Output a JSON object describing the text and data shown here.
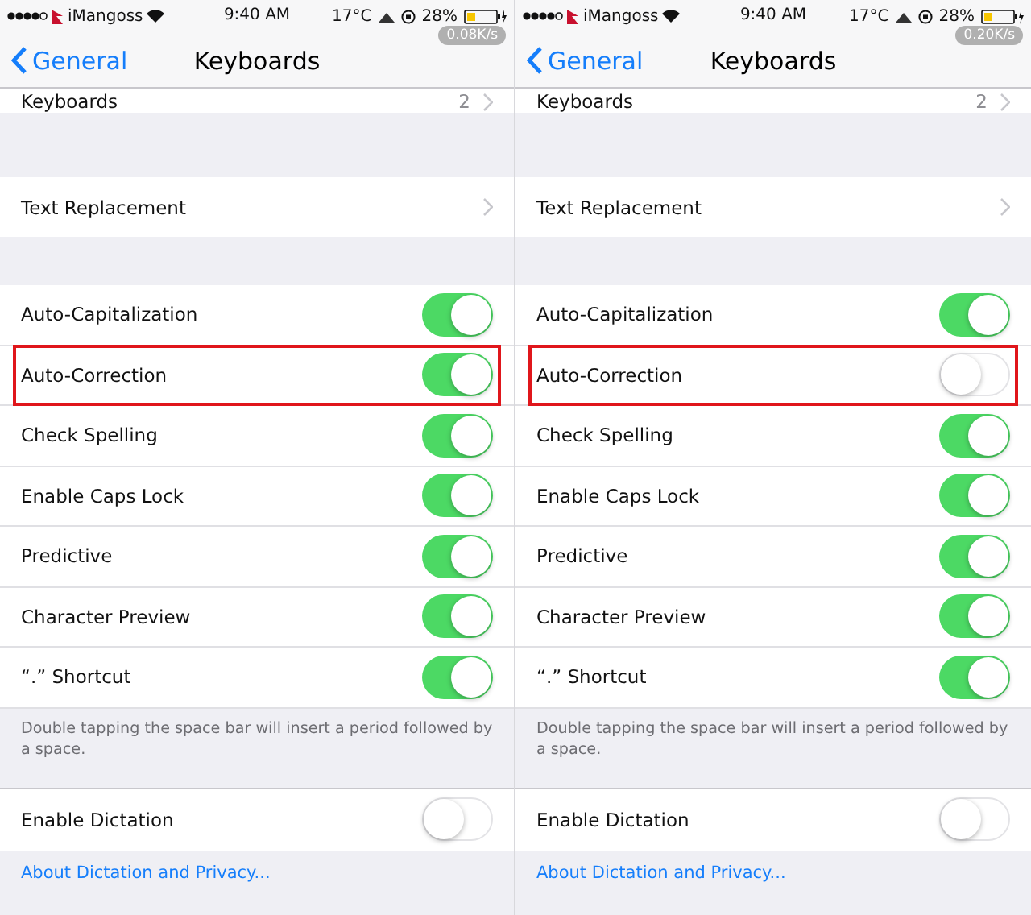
{
  "panels": [
    {
      "status_bar": {
        "carrier": "iMangoss",
        "time": "9:40 AM",
        "temperature": "17°C",
        "battery_percent": "28%",
        "net_speed": "0.08K/s"
      },
      "nav": {
        "back": "General",
        "title": "Keyboards"
      },
      "keyboards_row": {
        "label": "Keyboards",
        "value": "2"
      },
      "text_replacement": {
        "label": "Text Replacement"
      },
      "toggles": [
        {
          "label": "Auto-Capitalization",
          "on": true,
          "highlighted": false
        },
        {
          "label": "Auto-Correction",
          "on": true,
          "highlighted": true
        },
        {
          "label": "Check Spelling",
          "on": true,
          "highlighted": false
        },
        {
          "label": "Enable Caps Lock",
          "on": true,
          "highlighted": false
        },
        {
          "label": "Predictive",
          "on": true,
          "highlighted": false
        },
        {
          "label": "Character Preview",
          "on": true,
          "highlighted": false
        },
        {
          "label": "“.” Shortcut",
          "on": true,
          "highlighted": false
        }
      ],
      "footer": "Double tapping the space bar will insert a period followed by a space.",
      "dictation": {
        "label": "Enable Dictation",
        "on": false
      },
      "link": "About Dictation and Privacy..."
    },
    {
      "status_bar": {
        "carrier": "iMangoss",
        "time": "9:40 AM",
        "temperature": "17°C",
        "battery_percent": "28%",
        "net_speed": "0.20K/s"
      },
      "nav": {
        "back": "General",
        "title": "Keyboards"
      },
      "keyboards_row": {
        "label": "Keyboards",
        "value": "2"
      },
      "text_replacement": {
        "label": "Text Replacement"
      },
      "toggles": [
        {
          "label": "Auto-Capitalization",
          "on": true,
          "highlighted": false
        },
        {
          "label": "Auto-Correction",
          "on": false,
          "highlighted": true
        },
        {
          "label": "Check Spelling",
          "on": true,
          "highlighted": false
        },
        {
          "label": "Enable Caps Lock",
          "on": true,
          "highlighted": false
        },
        {
          "label": "Predictive",
          "on": true,
          "highlighted": false
        },
        {
          "label": "Character Preview",
          "on": true,
          "highlighted": false
        },
        {
          "label": "“.” Shortcut",
          "on": true,
          "highlighted": false
        }
      ],
      "footer": "Double tapping the space bar will insert a period followed by a space.",
      "dictation": {
        "label": "Enable Dictation",
        "on": false
      },
      "link": "About Dictation and Privacy..."
    }
  ]
}
